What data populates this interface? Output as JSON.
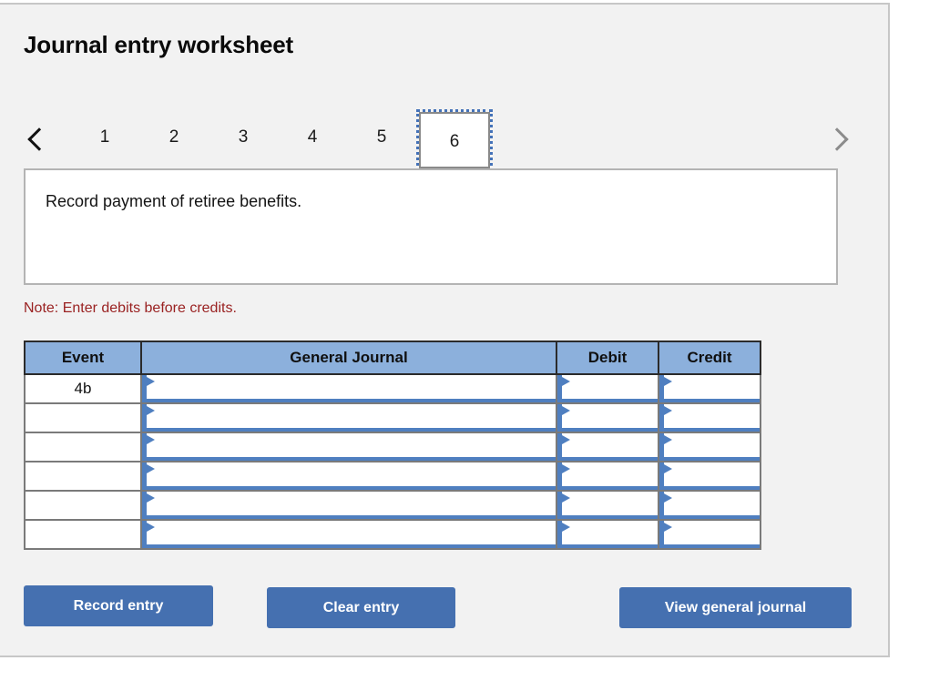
{
  "panel": {
    "title": "Journal entry worksheet"
  },
  "pager": {
    "prev_icon": "chevron-left-icon",
    "next_icon": "chevron-right-icon",
    "pages": [
      {
        "label": "1",
        "active": false
      },
      {
        "label": "2",
        "active": false
      },
      {
        "label": "3",
        "active": false
      },
      {
        "label": "4",
        "active": false
      },
      {
        "label": "5",
        "active": false
      },
      {
        "label": "6",
        "active": true
      }
    ],
    "active_page": "6"
  },
  "description": {
    "text": "Record payment of retiree benefits."
  },
  "note": {
    "text": "Note: Enter debits before credits."
  },
  "table": {
    "headers": {
      "event": "Event",
      "general_journal": "General Journal",
      "debit": "Debit",
      "credit": "Credit"
    },
    "rows": [
      {
        "event": "4b",
        "general_journal": "",
        "debit": "",
        "credit": ""
      },
      {
        "event": "",
        "general_journal": "",
        "debit": "",
        "credit": ""
      },
      {
        "event": "",
        "general_journal": "",
        "debit": "",
        "credit": ""
      },
      {
        "event": "",
        "general_journal": "",
        "debit": "",
        "credit": ""
      },
      {
        "event": "",
        "general_journal": "",
        "debit": "",
        "credit": ""
      },
      {
        "event": "",
        "general_journal": "",
        "debit": "",
        "credit": ""
      }
    ]
  },
  "buttons": {
    "record_entry": "Record entry",
    "clear_entry": "Clear entry",
    "view_general_journal": "View general journal"
  },
  "colors": {
    "header_blue": "#8cb0dc",
    "button_blue": "#4570b0",
    "input_marker_blue": "#4f7fc0",
    "note_red": "#9a2222",
    "panel_bg": "#f2f2f2"
  }
}
